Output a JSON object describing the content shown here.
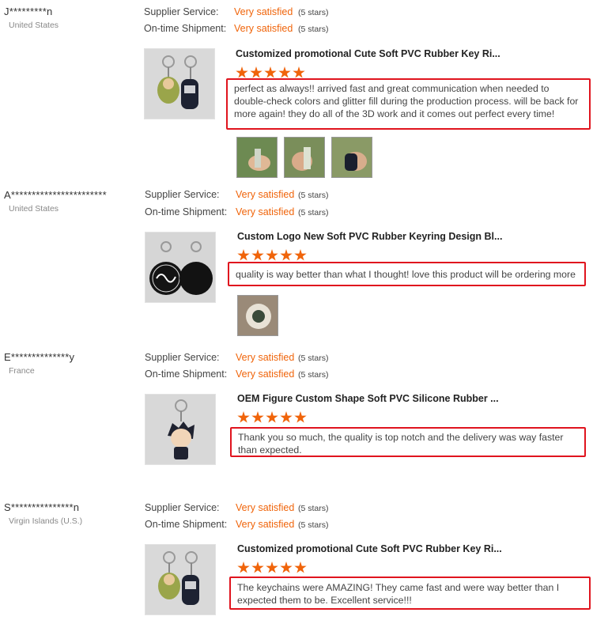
{
  "labels": {
    "supplier_service": "Supplier Service:",
    "ontime_shipment": "On-time Shipment:"
  },
  "colors": {
    "accent": "#f0640a",
    "highlight_border": "#e0141e"
  },
  "reviews": [
    {
      "buyer": "J*********n",
      "country": "United States",
      "supplier_service": "Very satisfied",
      "supplier_service_stars": "(5 stars)",
      "ontime_shipment": "Very satisfied",
      "ontime_shipment_stars": "(5 stars)",
      "product_title": "Customized promotional Cute Soft PVC Rubber Key Ri...",
      "rating": 5,
      "comment": "perfect as always!! arrived fast and great communication when needed to double-check colors and glitter fill during the production process. will be back for more again! they do all of the 3D work and it comes out perfect every time!",
      "photos": 3
    },
    {
      "buyer": "A***********************",
      "country": "United States",
      "supplier_service": "Very satisfied",
      "supplier_service_stars": "(5 stars)",
      "ontime_shipment": "Very satisfied",
      "ontime_shipment_stars": "(5 stars)",
      "product_title": "Custom Logo New Soft PVC Rubber Keyring Design Bl...",
      "rating": 5,
      "comment": "quality is way better than what I thought! love this product will be ordering more",
      "photos": 1
    },
    {
      "buyer": "E**************y",
      "country": "France",
      "supplier_service": "Very satisfied",
      "supplier_service_stars": "(5 stars)",
      "ontime_shipment": "Very satisfied",
      "ontime_shipment_stars": "(5 stars)",
      "product_title": "OEM Figure Custom Shape Soft PVC Silicone Rubber ...",
      "rating": 5,
      "comment": "Thank you so much, the quality is top notch and the delivery was way faster than expected.",
      "photos": 0
    },
    {
      "buyer": "S***************n",
      "country": "Virgin Islands (U.S.)",
      "supplier_service": "Very satisfied",
      "supplier_service_stars": "(5 stars)",
      "ontime_shipment": "Very satisfied",
      "ontime_shipment_stars": "(5 stars)",
      "product_title": "Customized promotional Cute Soft PVC Rubber Key Ri...",
      "rating": 5,
      "comment": "The keychains were AMAZING! They came fast and were way better than I expected them to be. Excellent service!!!",
      "photos": 0
    }
  ]
}
